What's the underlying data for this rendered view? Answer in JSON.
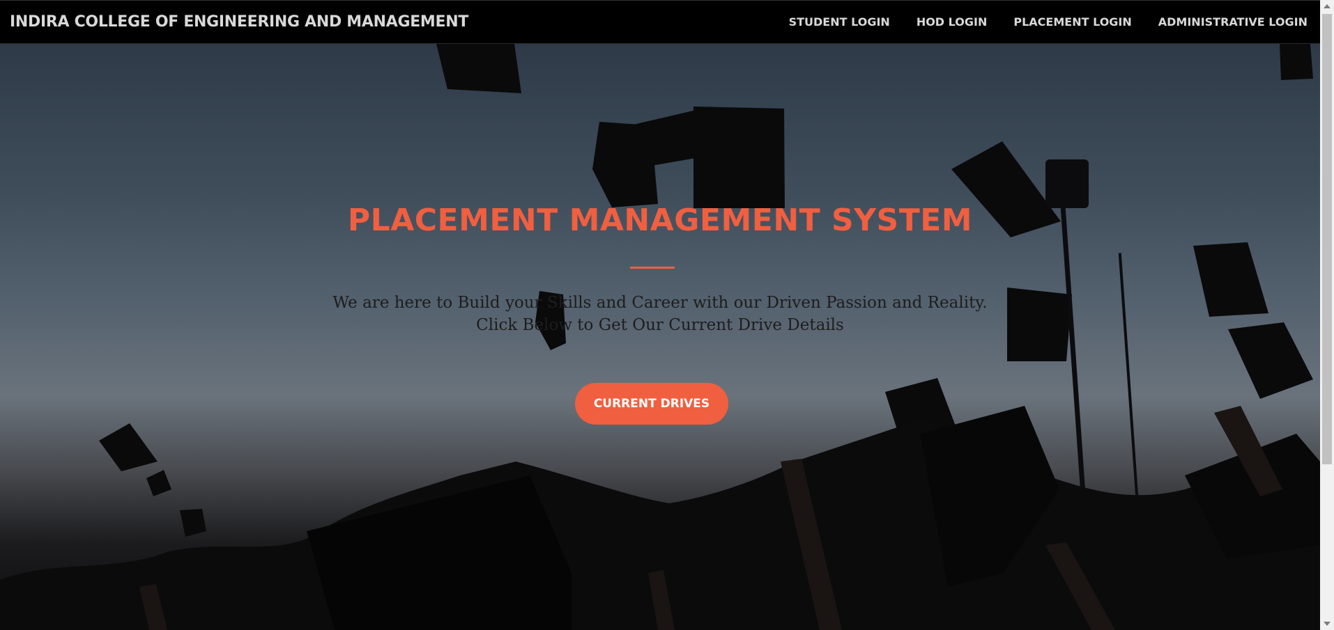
{
  "navbar": {
    "brand": "INDIRA COLLEGE OF ENGINEERING AND MANAGEMENT",
    "links": [
      {
        "label": "STUDENT LOGIN"
      },
      {
        "label": "HOD LOGIN"
      },
      {
        "label": "PLACEMENT LOGIN"
      },
      {
        "label": "ADMINISTRATIVE LOGIN"
      }
    ]
  },
  "hero": {
    "title": "PLACEMENT MANAGEMENT SYSTEM",
    "line1": "We are here to Build your Skills and Career with our Driven Passion and Reality.",
    "line2": "Click Below to Get Our Current Drive Details",
    "button_label": "CURRENT DRIVES",
    "background_image": "graduation-caps-thrown-in-air"
  },
  "colors": {
    "accent": "#f05f40",
    "navbar_bg": "#000000",
    "nav_text": "#d9d9d9",
    "hero_text": "#1d1d1d"
  }
}
